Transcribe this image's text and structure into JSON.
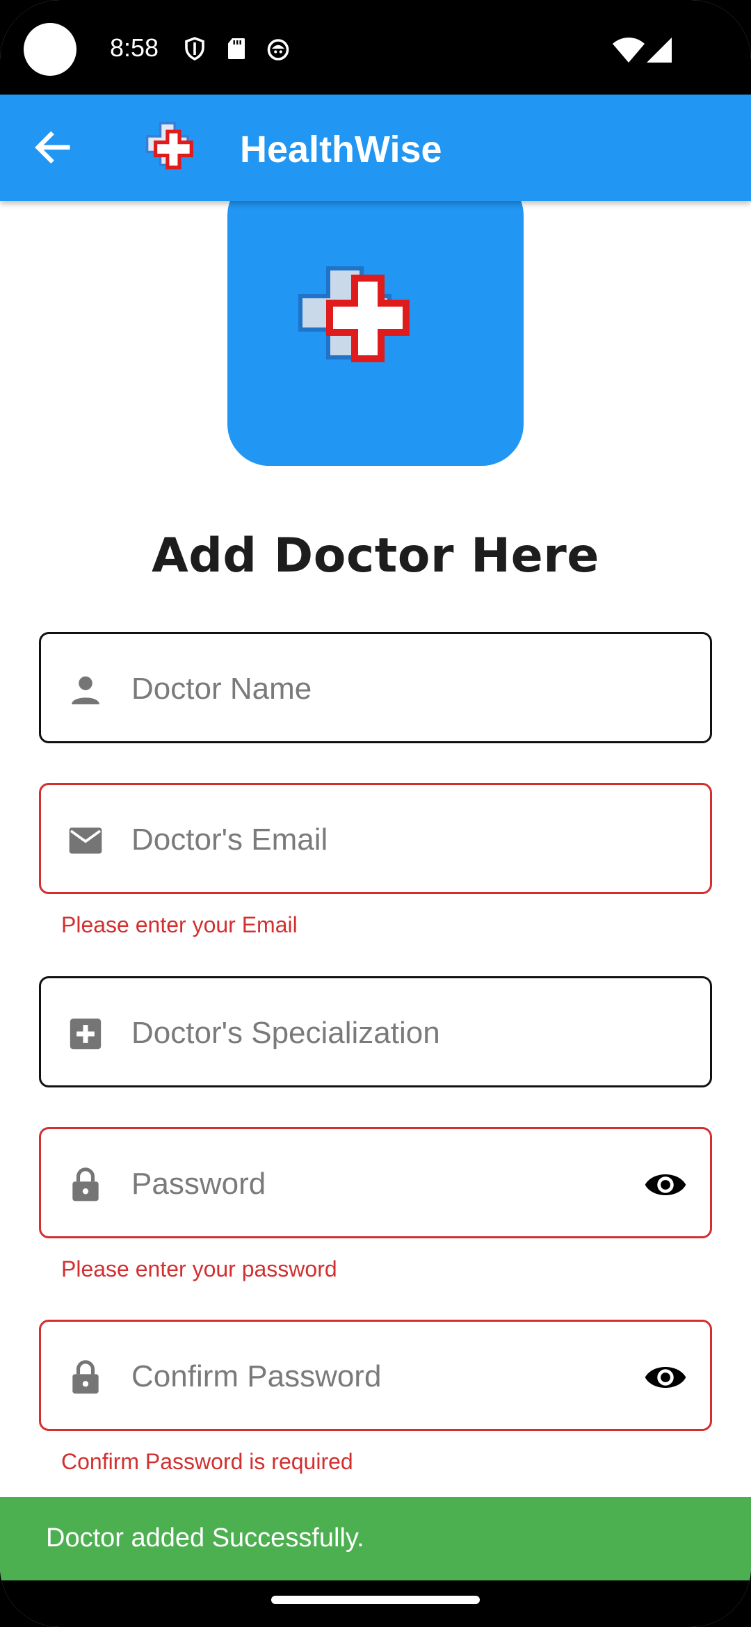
{
  "status_bar": {
    "time": "8:58"
  },
  "app_bar": {
    "title": "HealthWise"
  },
  "page": {
    "title": "Add Doctor Here"
  },
  "form": {
    "name_placeholder": "Doctor Name",
    "email_placeholder": "Doctor's Email",
    "email_error": "Please enter your Email",
    "specialization_placeholder": "Doctor's Specialization",
    "password_placeholder": "Password",
    "password_error": "Please enter your password",
    "confirm_placeholder": "Confirm Password",
    "confirm_error": "Confirm Password is required"
  },
  "snackbar": {
    "message": "Doctor added Successfully."
  },
  "colors": {
    "primary": "#2196F3",
    "error": "#d32f2f",
    "success": "#4CAF50"
  },
  "icons": {
    "back": "arrow-left-icon",
    "name": "person-icon",
    "email": "mail-icon",
    "specialization": "medical-plus-icon",
    "password": "lock-icon",
    "visibility": "eye-icon"
  }
}
